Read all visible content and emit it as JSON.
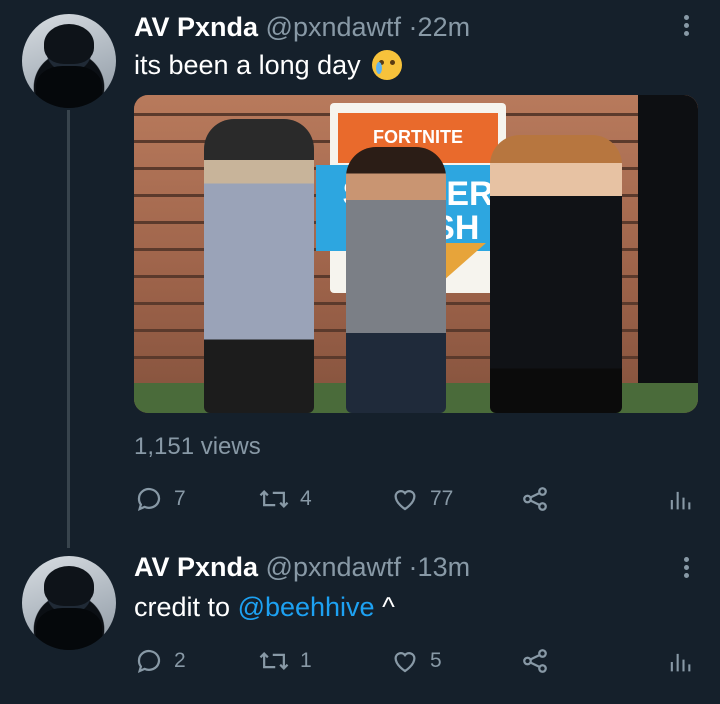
{
  "tweets": [
    {
      "name": "AV Pxnda",
      "handle": "@pxndawtf",
      "time": "22m",
      "text": "its been a long day",
      "emoji": "crying-face-icon",
      "media": {
        "banner_brand": "FORTNITE",
        "banner_title": "SUMMER SMASH"
      },
      "views": "1,151 views",
      "replies": "7",
      "retweets": "4",
      "likes": "77"
    },
    {
      "name": "AV Pxnda",
      "handle": "@pxndawtf",
      "time": "13m",
      "text_prefix": "credit to",
      "mention": "@beehhive",
      "text_suffix": "^",
      "replies": "2",
      "retweets": "1",
      "likes": "5"
    }
  ],
  "colors": {
    "background": "#15202b",
    "secondary_text": "#8899a6",
    "link": "#1da1f2",
    "thread_line": "#38444d"
  }
}
